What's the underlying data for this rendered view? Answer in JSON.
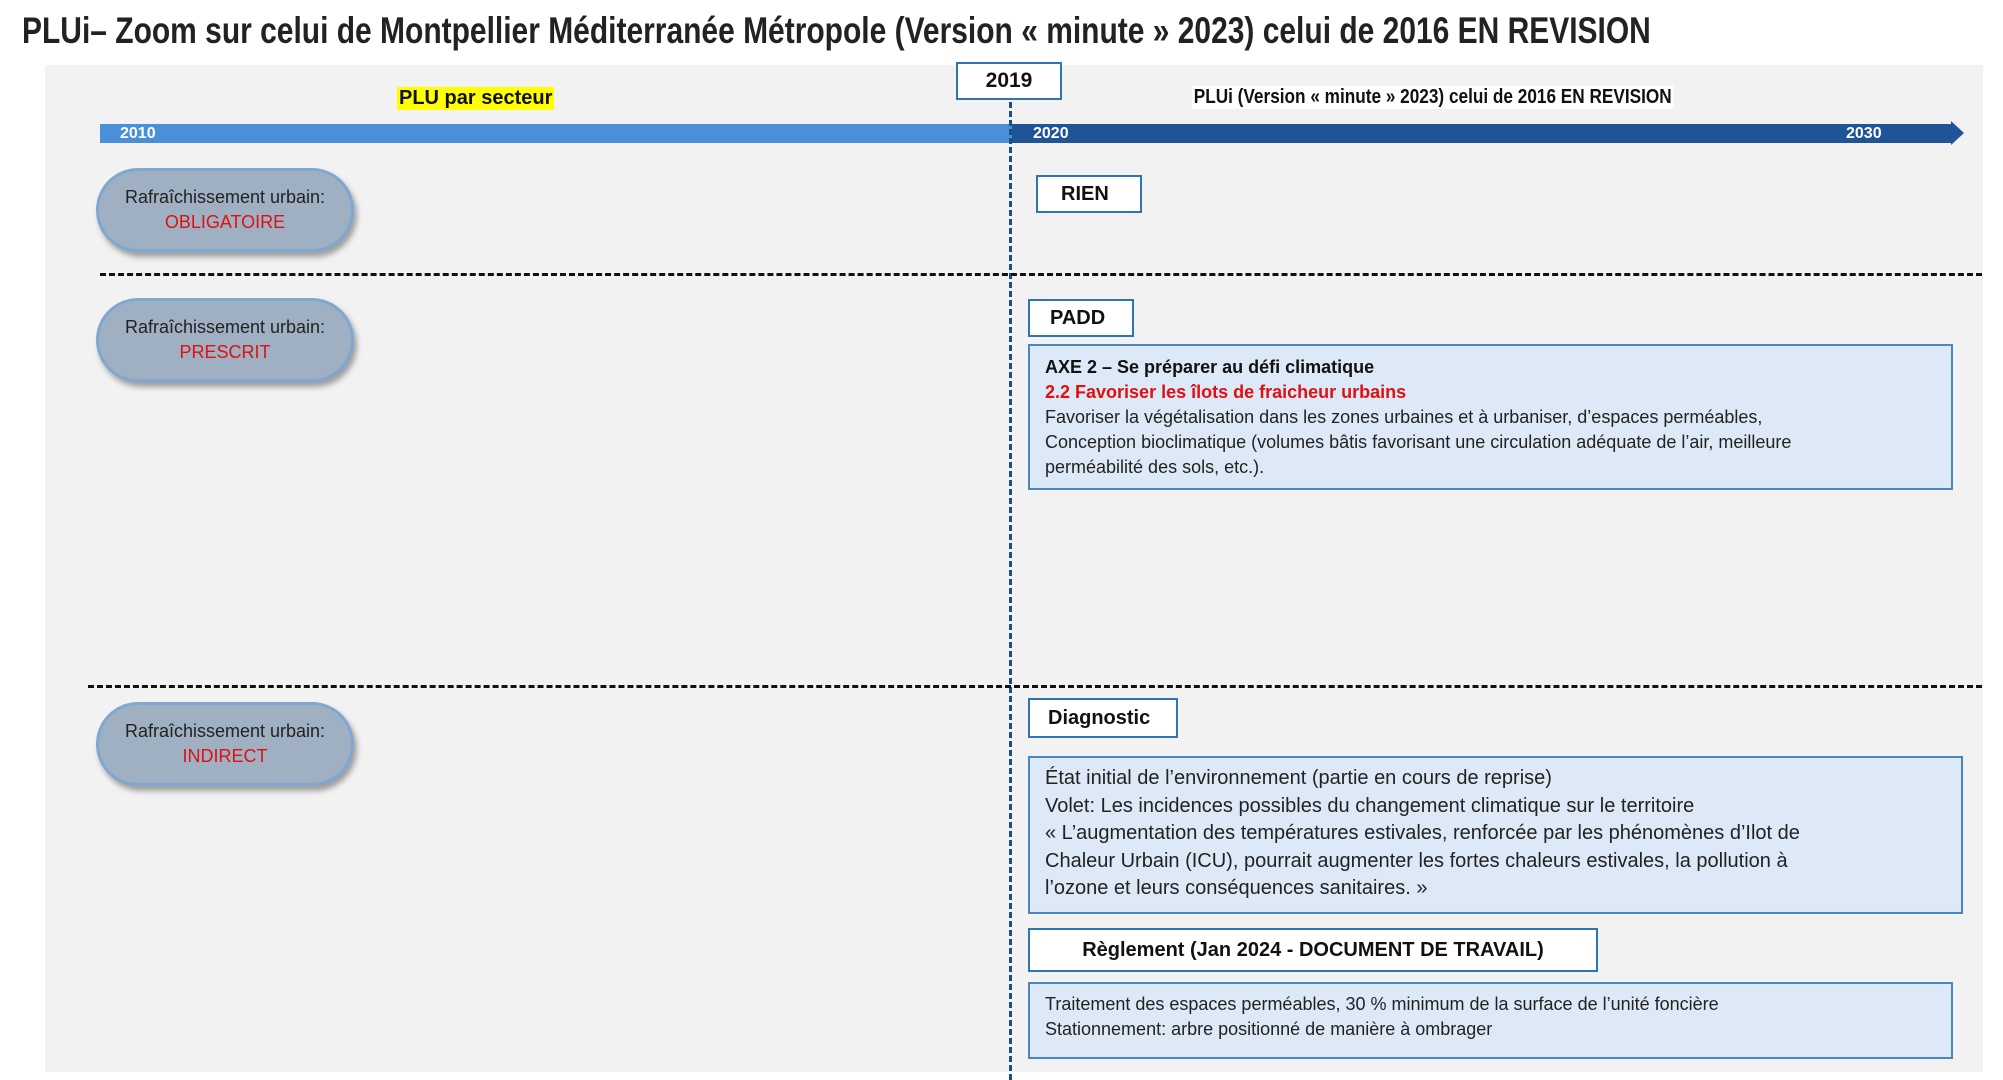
{
  "title": "PLUi– Zoom sur celui de Montpellier Méditerranée Métropole (Version « minute » 2023) celui de 2016 EN REVISION",
  "timeline": {
    "marker_year": "2019",
    "left_label": "PLU par secteur",
    "right_label": "PLUi (Version « minute » 2023) celui de 2016 EN REVISION",
    "year_start": "2010",
    "year_mid": "2020",
    "year_end": "2030"
  },
  "rows": [
    {
      "pill_label": "Rafraîchissement urbain:",
      "pill_status": "OBLIGATOIRE",
      "header": "RIEN"
    },
    {
      "pill_label": "Rafraîchissement urbain:",
      "pill_status": "PRESCRIT",
      "header": "PADD",
      "box": {
        "axe": "AXE 2 – Se préparer au défi climatique",
        "objectif": "2.2 Favoriser les îlots de fraicheur urbains",
        "line1": "Favoriser la végétalisation dans les zones urbaines et à urbaniser, d’espaces perméables,",
        "line2": "Conception bioclimatique (volumes bâtis favorisant une circulation adéquate de l’air, meilleure",
        "line3": "perméabilité des sols, etc.)."
      }
    },
    {
      "pill_label": "Rafraîchissement urbain:",
      "pill_status": "INDIRECT",
      "header": "Diagnostic",
      "box": {
        "line1": "État initial de l’environnement (partie en cours de reprise)",
        "line2": "Volet: Les incidences possibles du changement climatique sur le territoire",
        "line3": "« L’augmentation des températures estivales, renforcée par les phénomènes d’Ilot de",
        "line4": "Chaleur Urbain (ICU), pourrait augmenter les fortes chaleurs estivales, la pollution à",
        "line5": "l’ozone et leurs conséquences sanitaires. »"
      },
      "header2": "Règlement (Jan 2024 - DOCUMENT DE TRAVAIL)",
      "box2": {
        "line1": "Traitement des espaces perméables, 30 % minimum de la surface de l’unité foncière",
        "line2": "Stationnement: arbre positionné de manière à ombrager"
      }
    }
  ],
  "colors": {
    "bar_left": "#4a90d9",
    "bar_right": "#1f5597",
    "status_red": "#e01010",
    "highlight_yellow": "#ffff00",
    "box_fill": "#dde9f6"
  }
}
